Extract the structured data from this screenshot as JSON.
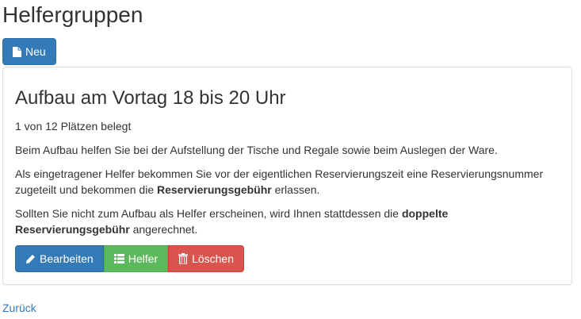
{
  "page": {
    "title": "Helfergruppen",
    "new_button_label": "Neu",
    "back_link_label": "Zurück"
  },
  "group": {
    "title": "Aufbau am Vortag 18 bis 20 Uhr",
    "occupancy": "1 von 12 Plätzen belegt",
    "paragraph1": "Beim Aufbau helfen Sie bei der Aufstellung der Tische und Regale sowie beim Auslegen der Ware.",
    "paragraph2_pre": "Als eingetragener Helfer bekommen Sie vor der eigentlichen Reservierungszeit eine Reservierungsnummer zugeteilt und bekommen die ",
    "paragraph2_bold": "Reservierungsgebühr",
    "paragraph2_post": " erlassen.",
    "paragraph3_pre": "Sollten Sie nicht zum Aufbau als Helfer erscheinen, wird Ihnen stattdessen die ",
    "paragraph3_bold": "doppelte Reservierungsgebühr",
    "paragraph3_post": " angerechnet.",
    "actions": {
      "edit_label": "Bearbeiten",
      "helpers_label": "Helfer",
      "delete_label": "Löschen"
    }
  },
  "icons": {
    "new": "file-icon",
    "edit": "pencil-icon",
    "helpers": "list-icon",
    "delete": "trash-icon"
  },
  "colors": {
    "primary": "#337ab7",
    "success": "#5cb85c",
    "danger": "#d9534f",
    "link": "#337ab7"
  }
}
